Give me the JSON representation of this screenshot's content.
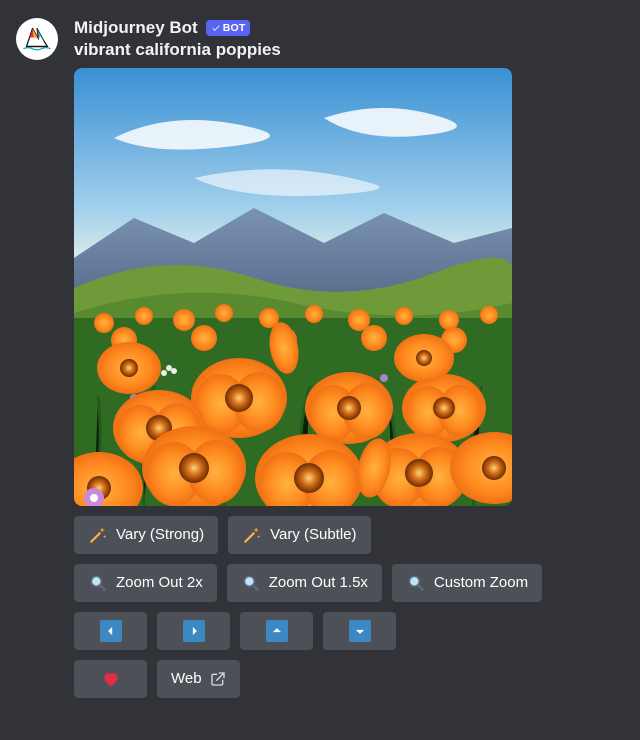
{
  "author": {
    "name": "Midjourney Bot",
    "badge_text": "BOT"
  },
  "prompt": "vibrant california poppies",
  "buttons": {
    "row1": {
      "vary_strong": "Vary (Strong)",
      "vary_subtle": "Vary (Subtle)"
    },
    "row2": {
      "zoom_out_2x": "Zoom Out 2x",
      "zoom_out_15x": "Zoom Out 1.5x",
      "custom_zoom": "Custom Zoom"
    },
    "row4": {
      "web": "Web"
    }
  }
}
